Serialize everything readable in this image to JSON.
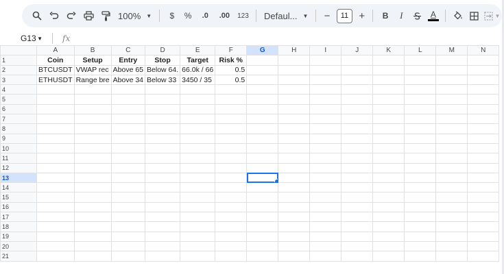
{
  "toolbar": {
    "zoom": "100%",
    "currency": "$",
    "percent": "%",
    "decrease_decimal": ".0",
    "increase_decimal": ".00",
    "number_format": "123",
    "font": "Defaul...",
    "font_size": "11",
    "minus": "−",
    "plus": "+",
    "bold": "B",
    "italic": "I",
    "text_color": "A"
  },
  "formula_bar": {
    "cell_ref": "G13",
    "fx": "fx"
  },
  "grid": {
    "columns": [
      "A",
      "B",
      "C",
      "D",
      "E",
      "F",
      "G",
      "H",
      "I",
      "J",
      "K",
      "L",
      "M",
      "N"
    ],
    "rows": [
      "1",
      "2",
      "3",
      "4",
      "5",
      "6",
      "7",
      "8",
      "9",
      "10",
      "11",
      "12",
      "13",
      "14",
      "15",
      "16",
      "17",
      "18",
      "19",
      "20",
      "21"
    ],
    "selected_cell": {
      "col": "G",
      "row": "13"
    },
    "header": [
      "Coin",
      "Setup",
      "Entry",
      "Stop",
      "Target",
      "Risk %"
    ],
    "data": [
      [
        "BTCUSDT",
        "VWAP rec",
        "Above 65",
        "Below 64.",
        "66.0k / 66",
        "0.5"
      ],
      [
        "ETHUSDT",
        "Range bre",
        "Above 34",
        "Below 33",
        "3450 / 35",
        "0.5"
      ]
    ]
  },
  "colors": {
    "selection": "#1a73e8",
    "toolbar_bg": "#f0f4f9",
    "header_bg": "#f8f9fa"
  }
}
